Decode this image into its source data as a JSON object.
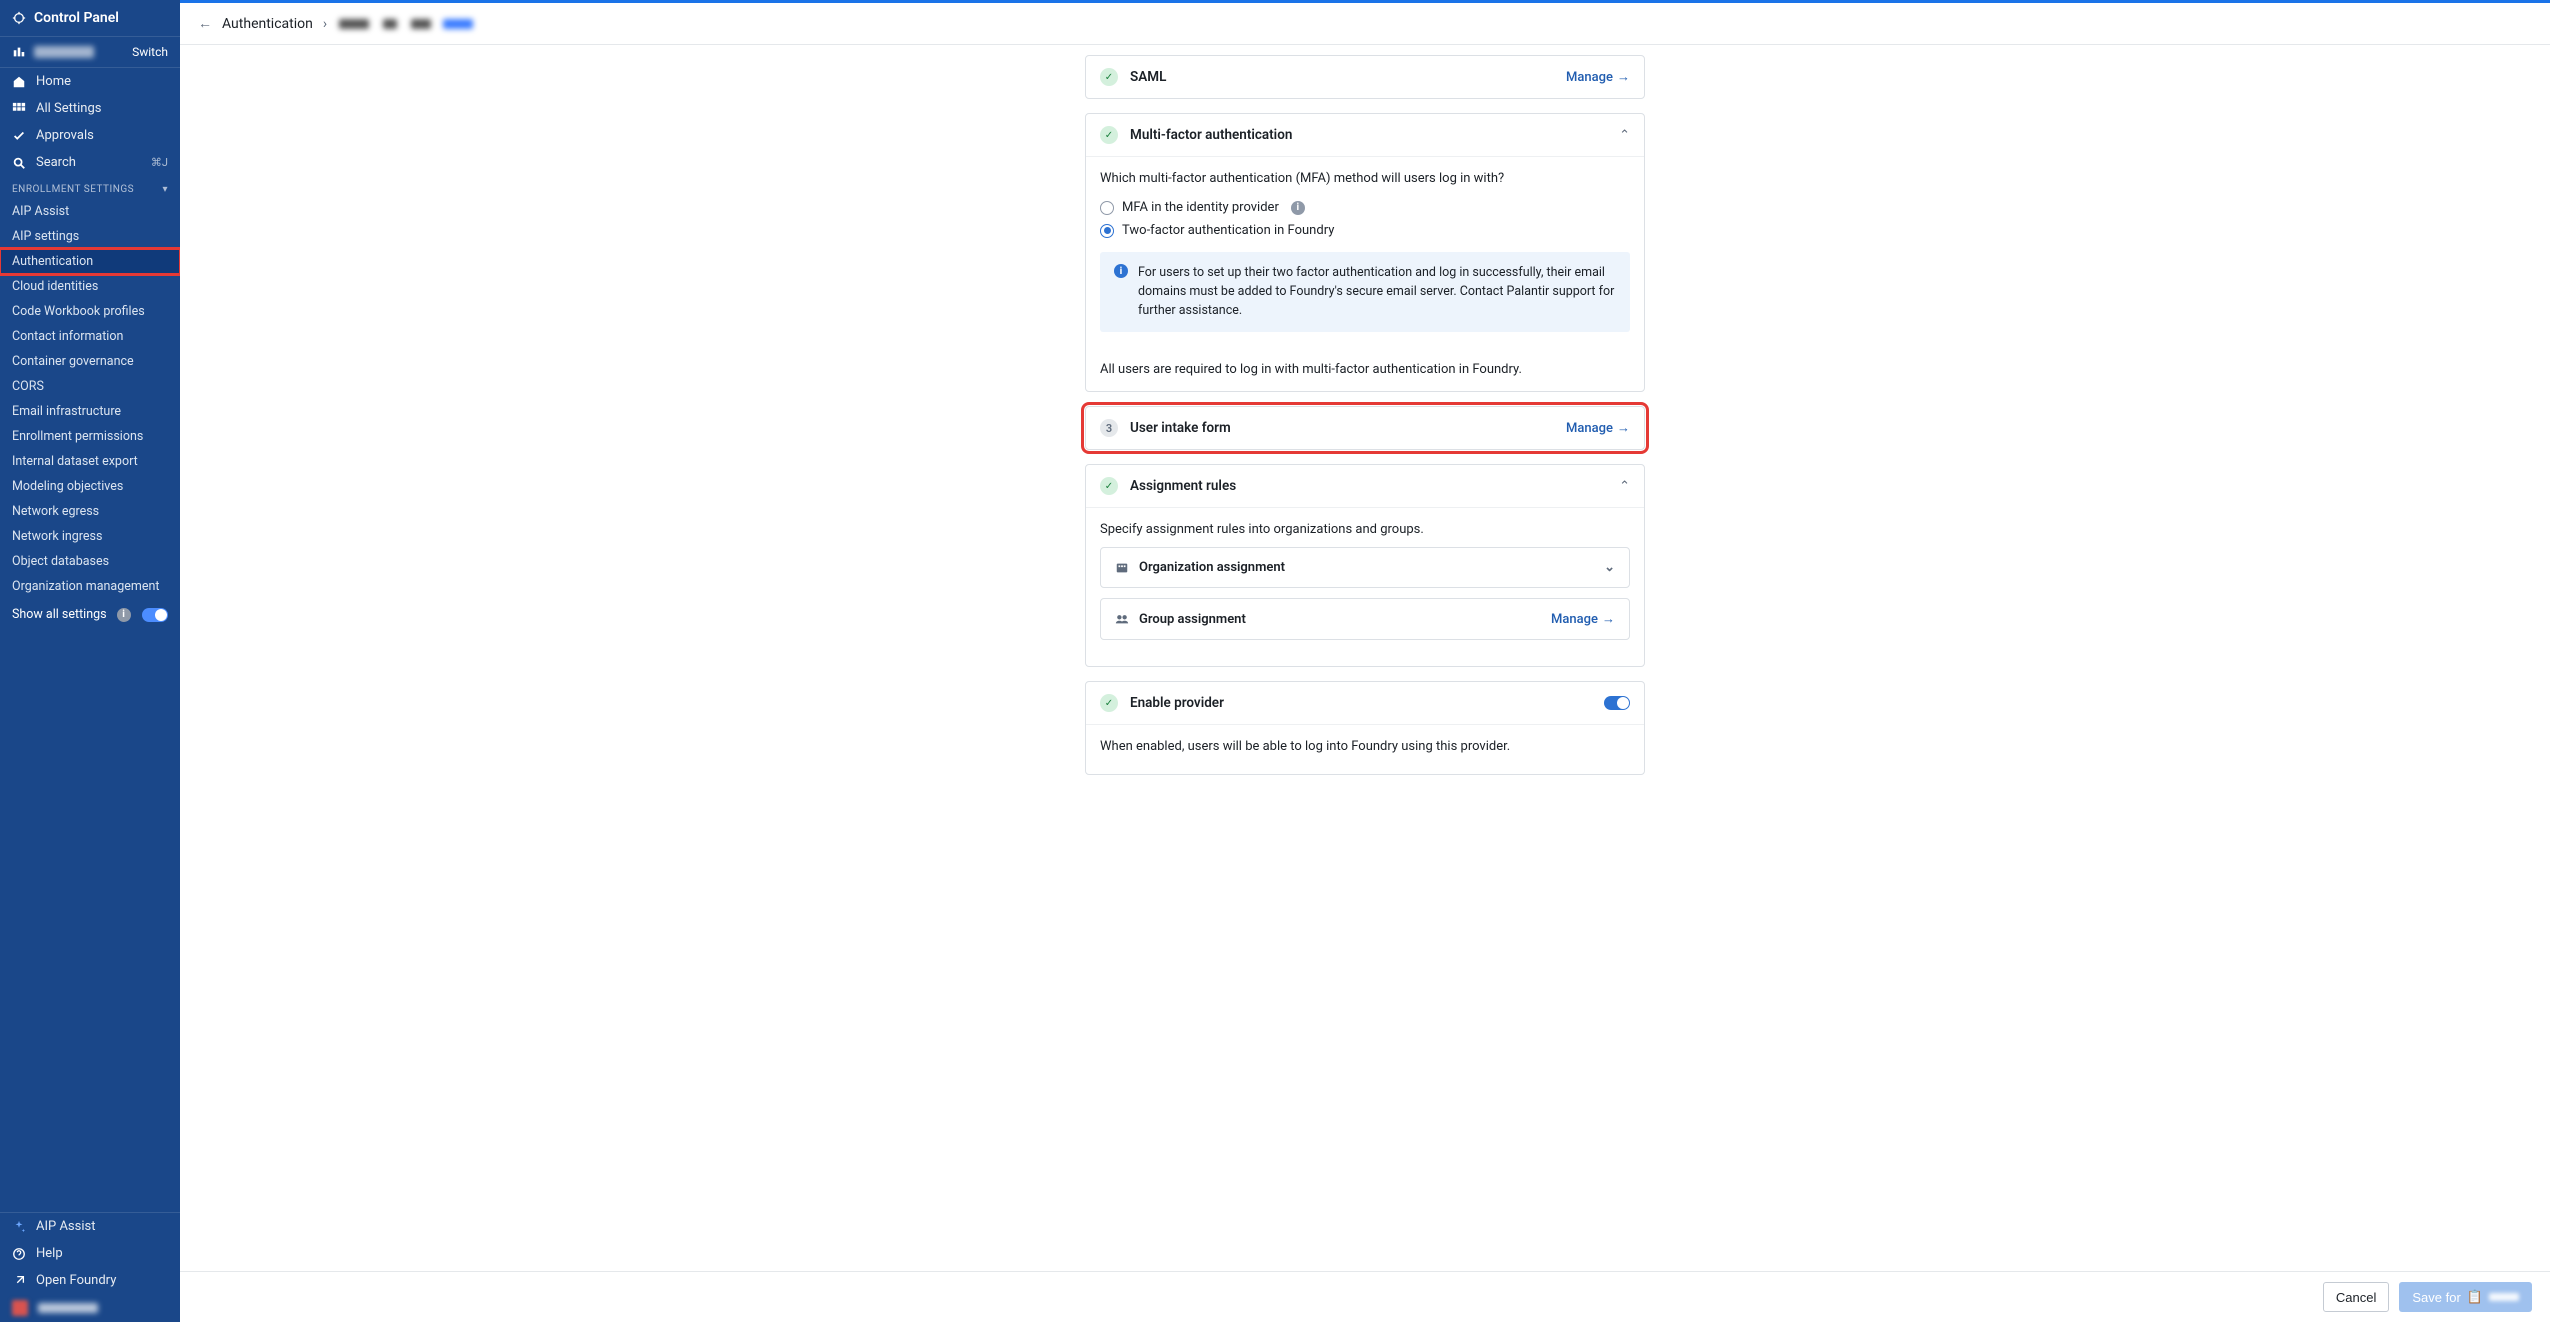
{
  "sidebar": {
    "title": "Control Panel",
    "switch_label": "Switch",
    "nav": {
      "home": "Home",
      "all_settings": "All Settings",
      "approvals": "Approvals",
      "search": "Search",
      "search_shortcut": "⌘J"
    },
    "section_label": "ENROLLMENT SETTINGS",
    "items": [
      "AIP Assist",
      "AIP settings",
      "Authentication",
      "Cloud identities",
      "Code Workbook profiles",
      "Contact information",
      "Container governance",
      "CORS",
      "Email infrastructure",
      "Enrollment permissions",
      "Internal dataset export",
      "Modeling objectives",
      "Network egress",
      "Network ingress",
      "Object databases",
      "Organization management"
    ],
    "show_all": "Show all settings",
    "bottom": {
      "aip_assist": "AIP Assist",
      "help": "Help",
      "open_foundry": "Open Foundry"
    }
  },
  "breadcrumb": {
    "root": "Authentication"
  },
  "cards": {
    "saml": {
      "title": "SAML",
      "action": "Manage"
    },
    "mfa": {
      "title": "Multi-factor authentication",
      "prompt": "Which multi-factor authentication (MFA) method will users log in with?",
      "opt1": "MFA in the identity provider",
      "opt2": "Two-factor authentication in Foundry",
      "info": "For users to set up their two factor authentication and log in successfully, their email domains must be added to Foundry's secure email server. Contact Palantir support for further assistance.",
      "note": "All users are required to log in with multi-factor authentication in Foundry."
    },
    "intake": {
      "title": "User intake form",
      "action": "Manage",
      "num": "3"
    },
    "rules": {
      "title": "Assignment rules",
      "prompt": "Specify assignment rules into organizations and groups.",
      "org": "Organization assignment",
      "group": "Group assignment",
      "group_action": "Manage"
    },
    "enable": {
      "title": "Enable provider",
      "desc": "When enabled, users will be able to log into Foundry using this provider."
    }
  },
  "footer": {
    "cancel": "Cancel",
    "save": "Save for"
  }
}
